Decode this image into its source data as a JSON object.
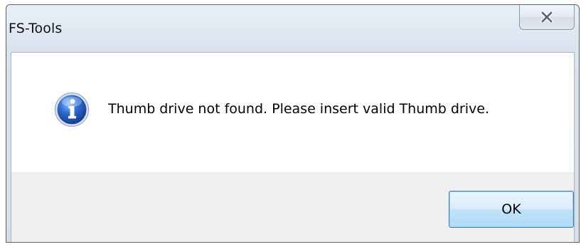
{
  "window": {
    "title": "FS-Tools"
  },
  "titlebar": {
    "close_icon": "close-x-icon"
  },
  "dialog": {
    "icon": "information-icon",
    "message": "Thumb drive not found. Please insert valid Thumb drive."
  },
  "buttons": {
    "ok_label": "OK"
  },
  "colors": {
    "ok_button_border": "#3c7fb1",
    "ok_button_fill": "#bfe3f8",
    "info_icon_blue": "#2a62c9"
  }
}
